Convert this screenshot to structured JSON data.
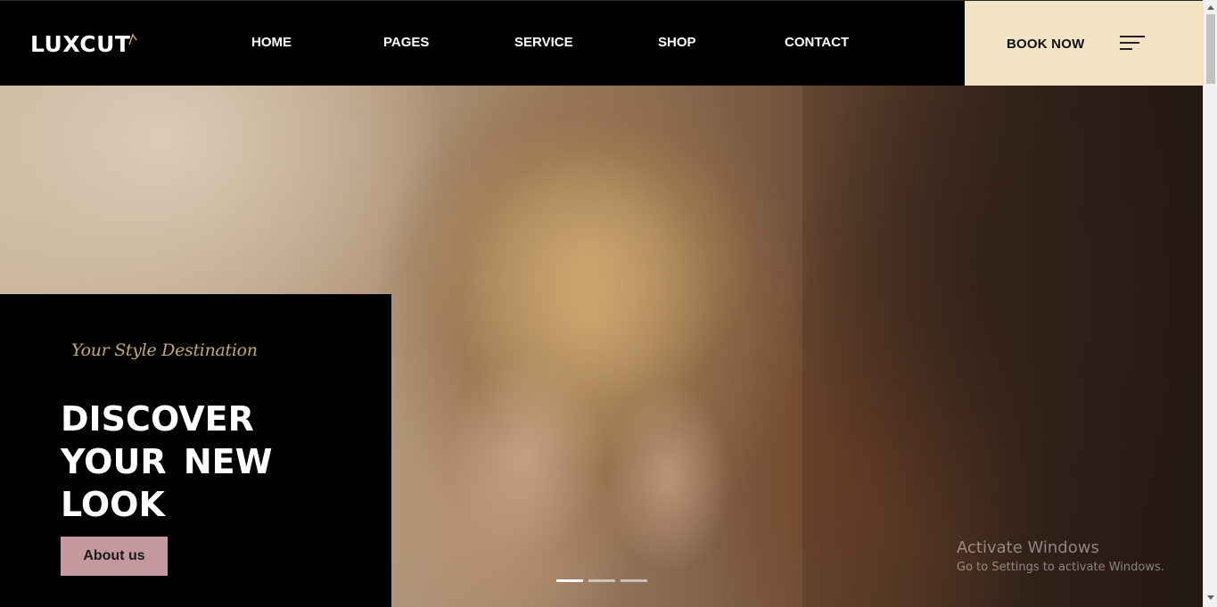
{
  "header": {
    "logo": "LUXCUT",
    "nav": [
      "HOME",
      "PAGES",
      "SERVICE",
      "SHOP",
      "CONTACT"
    ],
    "book_label": "BOOK NOW"
  },
  "hero": {
    "tagline": "Your Style Destination",
    "headline": "DISCOVER YOUR NEW LOOK",
    "button": "About us",
    "slides": {
      "count": 3,
      "active": 1
    }
  },
  "watermark": {
    "title": "Activate Windows",
    "subtitle": "Go to Settings to activate Windows."
  },
  "colors": {
    "header_bg": "#000000",
    "book_bg": "#f1e3c4",
    "button_bg": "#c5979f",
    "tagline": "#c6a870"
  }
}
